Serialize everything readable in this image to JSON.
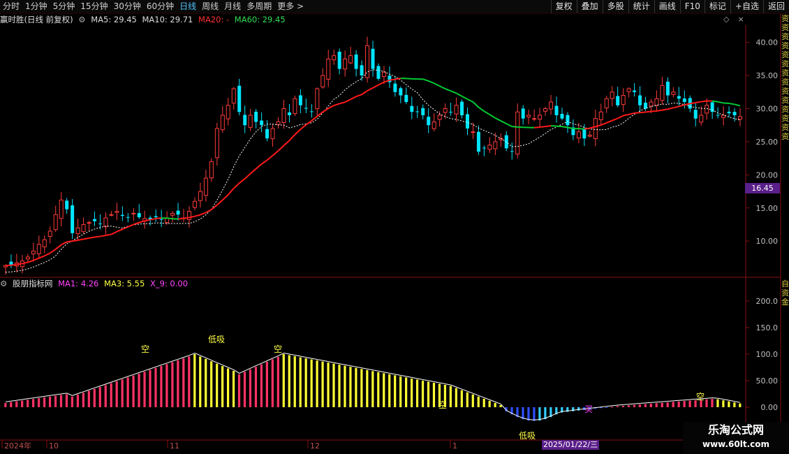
{
  "toolbar": {
    "periods": [
      "分时",
      "1分钟",
      "5分钟",
      "15分钟",
      "30分钟",
      "60分钟",
      "日线",
      "周线",
      "月线",
      "多周期",
      "更多 >"
    ],
    "active_period": "日线",
    "actions": [
      "复权",
      "叠加",
      "多股",
      "统计",
      "画线",
      "F10",
      "标记",
      "+自选",
      "返回"
    ]
  },
  "main_info": {
    "title": "赢时胜(日线 前复权)",
    "ma5": "MA5: 29.45",
    "ma10": "MA10: 29.71",
    "ma20": "MA20: -",
    "ma60": "MA60: 29.45"
  },
  "sub_info": {
    "title": "股朋指标网",
    "ma1": "MA1: 4.26",
    "ma3": "MA3: 5.55",
    "x9": "X_9: 0.00"
  },
  "price_axis": [
    "40.00",
    "35.00",
    "30.00",
    "25.00",
    "20.00",
    "15.00",
    "10.00"
  ],
  "sub_axis": [
    "200.0",
    "150.0",
    "100.0",
    "50.00",
    "0.00"
  ],
  "current_price": "16.45",
  "date_axis": [
    {
      "label": "2024年"
    },
    {
      "label": "10"
    },
    {
      "label": "11"
    },
    {
      "label": "12"
    },
    {
      "label": "1"
    }
  ],
  "cursor_date": "2025/01/22/三",
  "annotations": {
    "low1": "低吸",
    "low2": "低吸",
    "empty": "空",
    "buy": "买"
  },
  "right_strip": "资资资资资资资资资资资资资资",
  "right_strip2": "自资金",
  "watermark": {
    "line1": "乐淘公式网",
    "line2": "www.60lt.com"
  },
  "colors": {
    "up": "#ff3b3b",
    "down": "#00e5ff",
    "ma20": "#ff1a1a",
    "ma60": "#00cc33",
    "ma10": "#ffffff",
    "bar_red": "#ff3366",
    "bar_yellow": "#ffff33",
    "bar_blue": "#3050ff",
    "bar_cyan": "#33ccff",
    "axis": "#8a1010"
  }
}
